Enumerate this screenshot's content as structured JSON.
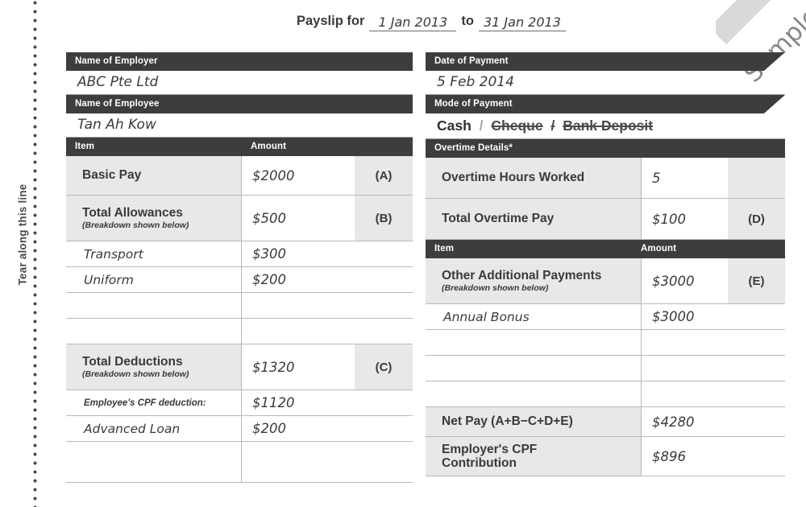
{
  "tear": {
    "label": "Tear along this line"
  },
  "watermark": {
    "text": "Sample"
  },
  "title": {
    "label": "Payslip for",
    "period_from": "1 Jan 2013",
    "to_label": "to",
    "period_to": "31 Jan 2013"
  },
  "left": {
    "employer": {
      "header": "Name of Employer",
      "value": "ABC Pte Ltd"
    },
    "employee": {
      "header": "Name of Employee",
      "value": "Tan Ah Kow"
    },
    "table": {
      "col_item": "Item",
      "col_amount": "Amount",
      "rows": [
        {
          "label": "Basic Pay",
          "note": "",
          "amount": "$2000",
          "code": "(A)",
          "kind": "main"
        },
        {
          "label": "Total Allowances",
          "note": "(Breakdown shown below)",
          "amount": "$500",
          "code": "(B)",
          "kind": "main"
        },
        {
          "label": "Transport",
          "note": "",
          "amount": "$300",
          "code": "",
          "kind": "sub"
        },
        {
          "label": "Uniform",
          "note": "",
          "amount": "$200",
          "code": "",
          "kind": "sub"
        },
        {
          "label": "",
          "note": "",
          "amount": "",
          "code": "",
          "kind": "sub"
        },
        {
          "label": "",
          "note": "",
          "amount": "",
          "code": "",
          "kind": "sub"
        },
        {
          "label": "Total Deductions",
          "note": "(Breakdown shown below)",
          "amount": "$1320",
          "code": "(C)",
          "kind": "main"
        },
        {
          "label": "Employee's CPF deduction:",
          "note": "",
          "amount": "$1120",
          "code": "",
          "kind": "sub-printed"
        },
        {
          "label": "Advanced Loan",
          "note": "",
          "amount": "$200",
          "code": "",
          "kind": "sub"
        },
        {
          "label": "",
          "note": "",
          "amount": "",
          "code": "",
          "kind": "sub"
        }
      ]
    }
  },
  "right": {
    "date_of_payment": {
      "header": "Date of Payment",
      "value": "5 Feb 2014"
    },
    "mode_of_payment": {
      "header": "Mode of Payment",
      "selected": "Cash",
      "separator": "/",
      "option2": "Cheque",
      "option3": "Bank Deposit"
    },
    "overtime": {
      "header": "Overtime Details*",
      "rows": [
        {
          "label": "Overtime Hours Worked",
          "note": "",
          "amount": "5",
          "code": "",
          "kind": "main"
        },
        {
          "label": "Total Overtime Pay",
          "note": "",
          "amount": "$100",
          "code": "(D)",
          "kind": "main"
        }
      ]
    },
    "table": {
      "col_item": "Item",
      "col_amount": "Amount",
      "rows": [
        {
          "label": "Other Additional Payments",
          "note": "(Breakdown shown below)",
          "amount": "$3000",
          "code": "(E)",
          "kind": "main"
        },
        {
          "label": "Annual Bonus",
          "note": "",
          "amount": "$3000",
          "code": "",
          "kind": "sub"
        },
        {
          "label": "",
          "note": "",
          "amount": "",
          "code": "",
          "kind": "sub"
        },
        {
          "label": "",
          "note": "",
          "amount": "",
          "code": "",
          "kind": "sub"
        },
        {
          "label": "",
          "note": "",
          "amount": "",
          "code": "",
          "kind": "sub"
        }
      ],
      "totals": [
        {
          "label": "Net Pay (A+B−C+D+E)",
          "amount": "$4280"
        },
        {
          "label": "Employer's CPF\nContribution",
          "amount": "$896"
        }
      ]
    }
  },
  "colors": {
    "header_bar": "#3d3d40",
    "label_cell": "#e8e8ea",
    "grid_line": "#b9b9bb",
    "watermark": "#88888c"
  }
}
